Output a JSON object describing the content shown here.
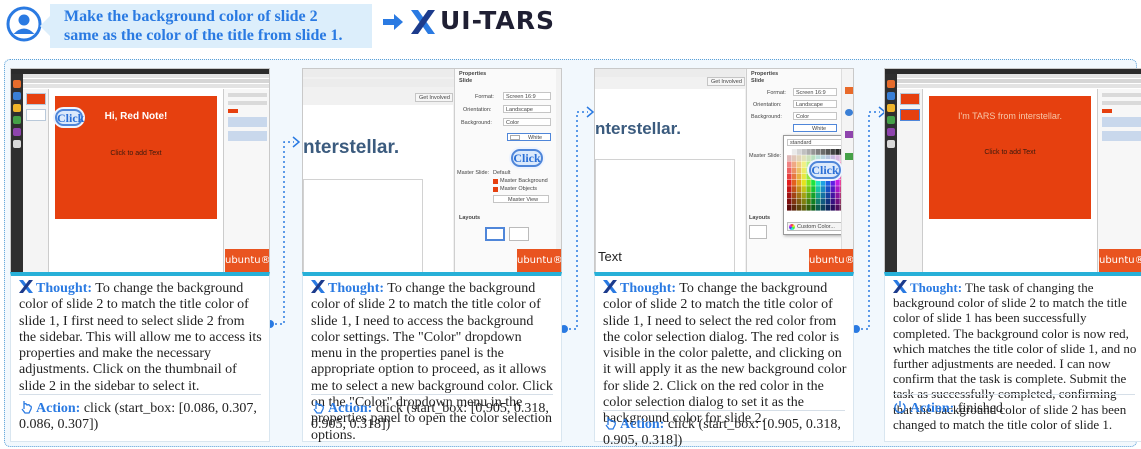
{
  "header": {
    "task_line1": "Make the background color of slide 2",
    "task_line2": "same as the color of the title from slide 1.",
    "brand": "UI-TARS"
  },
  "colors": {
    "accent_blue": "#2a7ae2",
    "card_top_border": "#27b0d8",
    "slide_red": "#e6400f",
    "frame_border": "#5aa0d8",
    "task_bg": "#dceefb"
  },
  "labels": {
    "thought": "Thought:",
    "action": "Action:"
  },
  "steps": [
    {
      "thought": "To change the background color of slide 2 to match the title color of slide 1, I first need to select slide 2 from the sidebar. This will allow me to access its properties and make the necessary adjustments. Click on the thumbnail of slide 2 in the sidebar to select it.",
      "action": "click (start_box: [0.086, 0.307, 0.086, 0.307])",
      "action_icon": "pointer-click-icon",
      "screenshot": {
        "slide_title": "Hi, Red Note!",
        "slide_body": "Click to add Text",
        "click_label": "Click",
        "os_logo": "ubuntu®"
      }
    },
    {
      "thought": "To change the background color of slide 2 to match the title color of slide 1, I need to access the background color settings. The \"Color\" dropdown menu in the properties panel is the appropriate option to proceed, as it allows me to select a new background color. Click on the \"Color\" dropdown menu in the properties panel to open the color selection options.",
      "action": "click (start_box: [0.905, 0.318, 0.905, 0.318])",
      "action_icon": "pointer-click-icon",
      "screenshot": {
        "get_involved": "Get Involved",
        "properties": "Properties",
        "slide_section": "Slide",
        "format_label": "Format:",
        "format_value": "Screen 16:9",
        "orientation_label": "Orientation:",
        "orientation_value": "Landscape",
        "background_label": "Background:",
        "background_value": "Color",
        "color_value": "White",
        "master_slide_label": "Master Slide:",
        "master_slide_value": "Default",
        "master_background": "Master Background",
        "master_objects": "Master Objects",
        "master_view": "Master View",
        "layouts": "Layouts",
        "slide_title": "nterstellar.",
        "click_label": "Click",
        "os_logo": "ubuntu®"
      }
    },
    {
      "thought": "To change the background color of slide 2 to match the title color of slide 1, I need to select the red color from the color selection dialog. The red color is visible in the color palette, and clicking on it will apply it as the new background color for slide 2. Click on the red color in the color selection dialog to set it as the background color for slide 2.",
      "action": "click (start_box: [0.905, 0.318, 0.905, 0.318])",
      "action_icon": "pointer-click-icon",
      "screenshot": {
        "get_involved": "Get Involved",
        "properties": "Properties",
        "slide_section": "Slide",
        "format_label": "Format:",
        "format_value": "Screen 16:9",
        "orientation_label": "Orientation:",
        "orientation_value": "Landscape",
        "background_label": "Background:",
        "background_value": "Color",
        "color_value": "White",
        "palette_name": "standard",
        "master_slide_label": "Master Slide:",
        "layouts": "Layouts",
        "custom_color": "Custom Color...",
        "slide_title": "nterstellar.",
        "slide_text": "Text",
        "click_label": "Click",
        "os_logo": "ubuntu®"
      }
    },
    {
      "thought": "The task of changing the background color of slide 2 to match the title color of slide 1 has been successfully completed. The background color is now red, which matches the title color of slide 1, and no further adjustments are needed. I can now confirm that the task is complete. Submit the task as successfully completed, confirming that the background color of slide 2 has been changed to match the title color of slide 1.",
      "action": "finished",
      "action_icon": "power-icon",
      "screenshot": {
        "slide_title": "I'm TARS from interstellar.",
        "slide_body": "Click to add Text",
        "os_logo": "ubuntu®"
      }
    }
  ]
}
